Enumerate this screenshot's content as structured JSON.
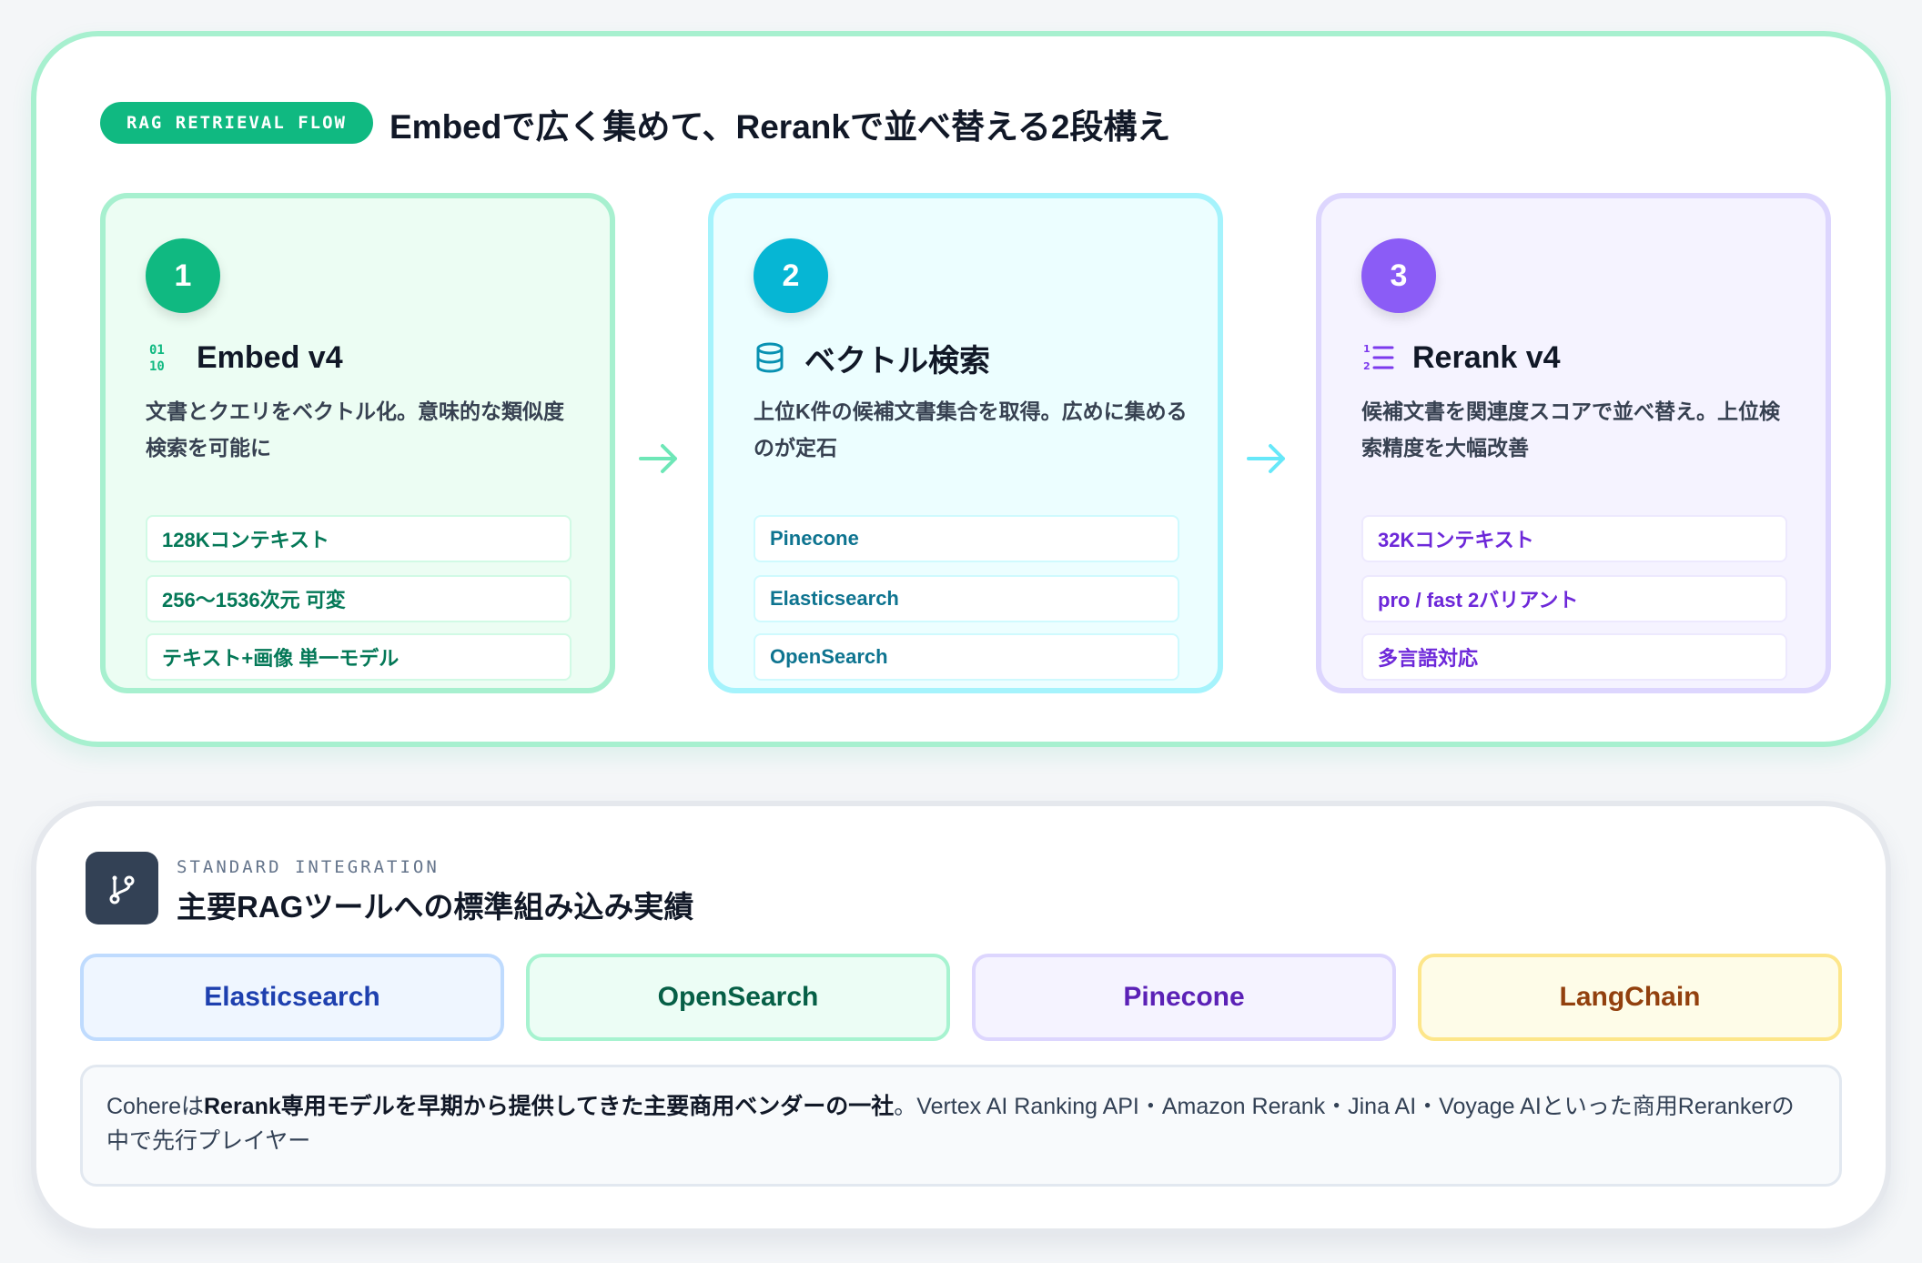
{
  "flow": {
    "tag": "RAG RETRIEVAL FLOW",
    "title": "Embedで広く集めて、Rerankで並べ替える2段構え",
    "steps": [
      {
        "number": "1",
        "icon": "binary-icon",
        "title": "Embed v4",
        "description": "文書とクエリをベクトル化。意味的な類似度検索を可能に",
        "chips": [
          "128Kコンテキスト",
          "256〜1536次元 可変",
          "テキスト+画像 単一モデル"
        ],
        "accent": "#10b981"
      },
      {
        "number": "2",
        "icon": "database-icon",
        "title": "ベクトル検索",
        "description": "上位K件の候補文書集合を取得。広めに集めるのが定石",
        "chips": [
          "Pinecone",
          "Elasticsearch",
          "OpenSearch"
        ],
        "accent": "#06b6d4"
      },
      {
        "number": "3",
        "icon": "ranked-list-icon",
        "title": "Rerank v4",
        "description": "候補文書を関連度スコアで並べ替え。上位検索精度を大幅改善",
        "chips": [
          "32Kコンテキスト",
          "pro / fast 2バリアント",
          "多言語対応"
        ],
        "accent": "#8b5cf6"
      }
    ]
  },
  "integration": {
    "icon": "git-branch-icon",
    "eyebrow": "STANDARD INTEGRATION",
    "title": "主要RAGツールへの標準組み込み実績",
    "tools": [
      "Elasticsearch",
      "OpenSearch",
      "Pinecone",
      "LangChain"
    ],
    "note": {
      "prefix": "Cohereは",
      "emphasis": "Rerank専用モデルを早期から提供してきた主要商用ベンダーの一社",
      "suffix": "。Vertex AI Ranking API・Amazon Rerank・Jina AI・Voyage AIといった商用Rerankerの中で先行プレイヤー"
    }
  }
}
